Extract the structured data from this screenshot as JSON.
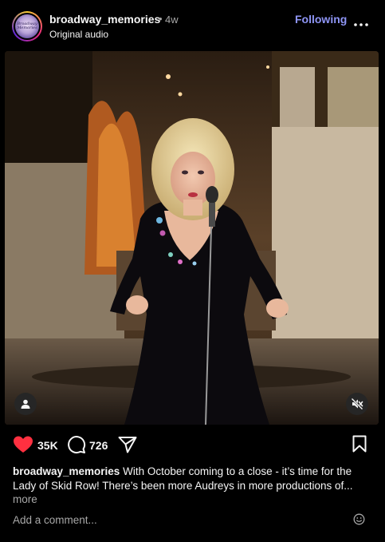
{
  "post": {
    "username": "broadway_memories",
    "separator": "•",
    "age": "4w",
    "audio": "Original audio",
    "follow_label": "Following",
    "avatar_text": "Broadway Memories"
  },
  "media": {
    "tag_icon": "person-icon",
    "mute_icon": "speaker-muted-icon"
  },
  "actions": {
    "likes": "35K",
    "comments": "726",
    "like_color": "#ff3040"
  },
  "caption": {
    "username": "broadway_memories",
    "text": "With October coming to a close - it’s time for the Lady of Skid Row! There’s been more Audreys in more productions of...",
    "more_label": "more"
  },
  "comment_box": {
    "placeholder": "Add a comment..."
  }
}
